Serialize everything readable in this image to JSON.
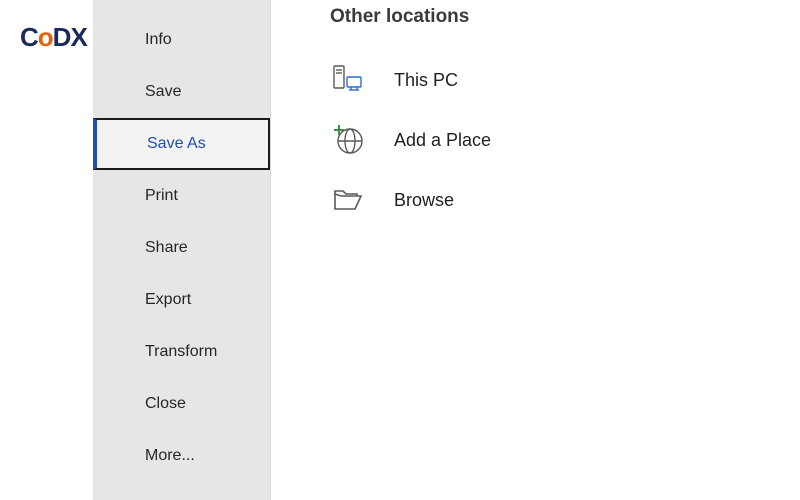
{
  "logo": {
    "text": "CoDX"
  },
  "sidebar": {
    "items": [
      {
        "label": "Info",
        "selected": false
      },
      {
        "label": "Save",
        "selected": false
      },
      {
        "label": "Save As",
        "selected": true
      },
      {
        "label": "Print",
        "selected": false
      },
      {
        "label": "Share",
        "selected": false
      },
      {
        "label": "Export",
        "selected": false
      },
      {
        "label": "Transform",
        "selected": false
      },
      {
        "label": "Close",
        "selected": false
      },
      {
        "label": "More...",
        "selected": false
      }
    ]
  },
  "main": {
    "section_title": "Other locations",
    "locations": [
      {
        "label": "This PC",
        "icon": "this-pc-icon"
      },
      {
        "label": "Add a Place",
        "icon": "add-place-icon"
      },
      {
        "label": "Browse",
        "icon": "browse-icon"
      }
    ]
  }
}
